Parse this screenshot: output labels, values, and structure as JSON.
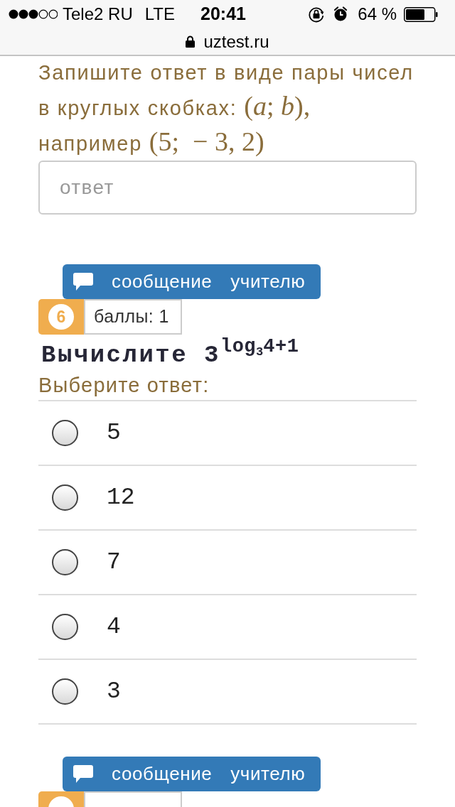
{
  "status_bar": {
    "carrier": "Tele2 RU",
    "network": "LTE",
    "time": "20:41",
    "battery": "64 %"
  },
  "address_bar": {
    "url": "uztest.ru"
  },
  "previous_question": {
    "instruction": [
      {
        "kind": "text",
        "text": "Запишите ответ в виде пары чисел в круглых скобках: "
      },
      {
        "kind": "math",
        "text": "(*a*; *b*),"
      },
      {
        "kind": "text",
        "text": " например "
      },
      {
        "kind": "math",
        "text": "(5;  − 3, 2)"
      }
    ],
    "answer_field": {
      "placeholder": "ответ"
    }
  },
  "questions": [
    {
      "message_button": "сообщение учителю",
      "number": "6",
      "points": "баллы: 1",
      "prompt": "Вычислите 3$^{log}$$_{3}$$^{4+1}$",
      "instruction": "Выберите ответ:",
      "options": [
        {
          "label": "5",
          "selected": false
        },
        {
          "label": "12",
          "selected": false
        },
        {
          "label": "7",
          "selected": false
        },
        {
          "label": "4",
          "selected": false
        },
        {
          "label": "3",
          "selected": false
        }
      ]
    },
    {
      "message_button": "сообщение учителю"
    }
  ]
}
